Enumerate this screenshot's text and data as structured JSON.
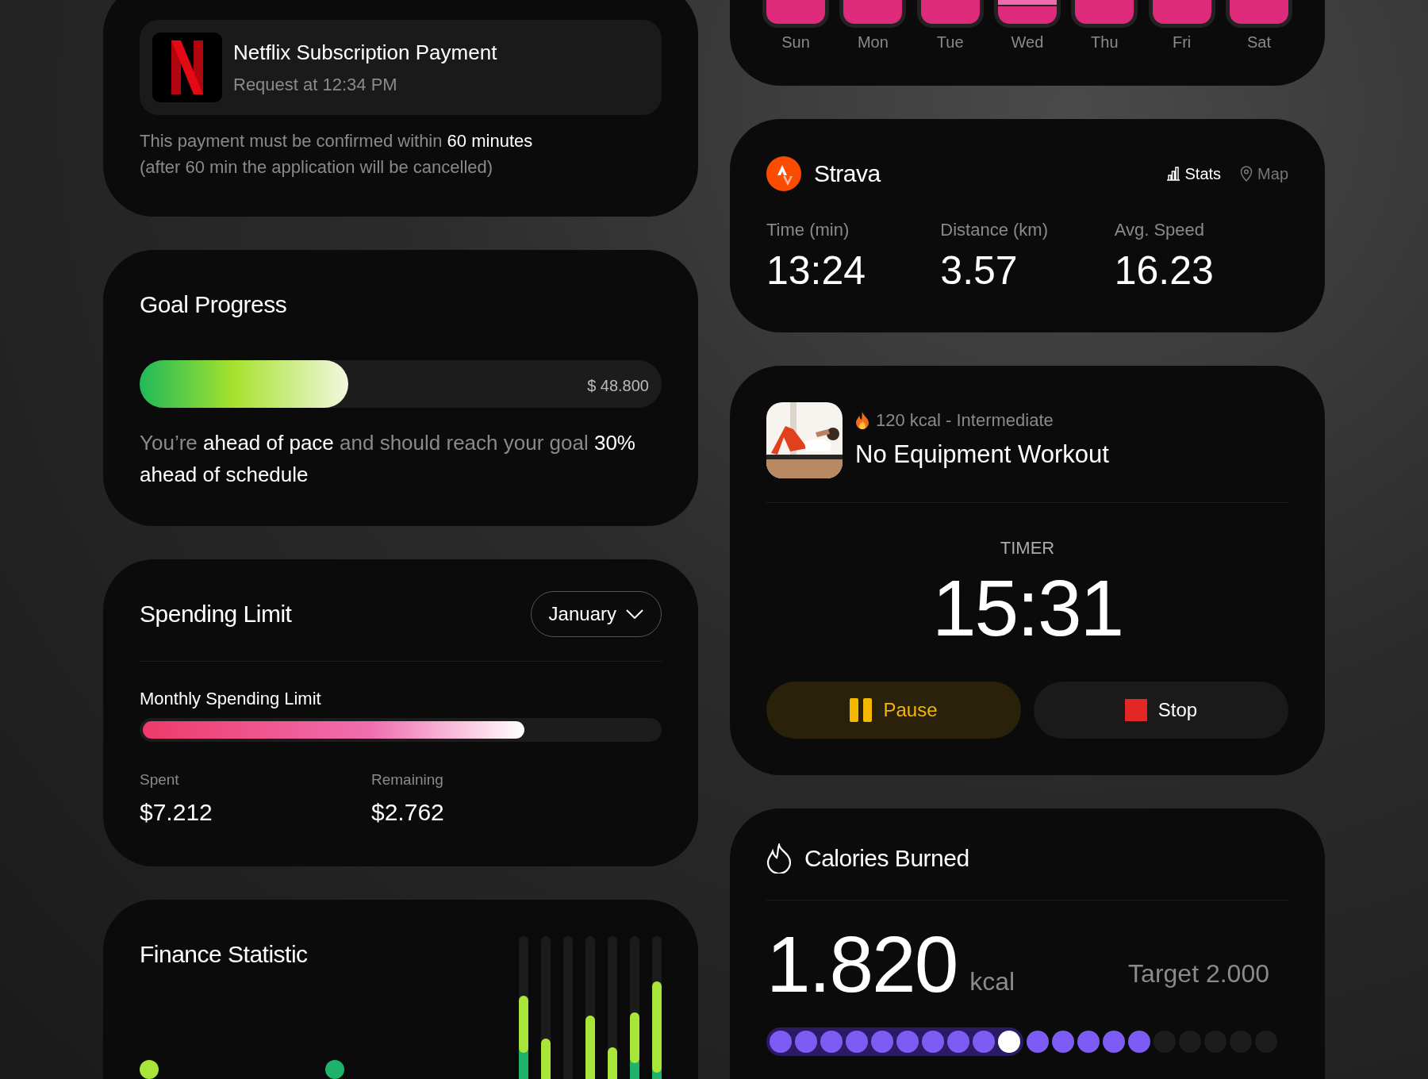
{
  "payment": {
    "title": "Netflix Subscription Payment",
    "subtitle": "Request at 12:34 PM",
    "notes": [
      "This payment must be confirmed within **60 minutes**",
      "(after 60 min the application will be cancelled)"
    ]
  },
  "goal": {
    "title": "Goal Progress",
    "level": 0.4,
    "amount": "$ 48.800",
    "message": "You’re **ahead of pace** and should reach your goal **30% ahead of schedule**"
  },
  "spending": {
    "title": "Spending Limit",
    "month": "January",
    "bar_label": "Monthly Spending Limit",
    "level": 0.74,
    "stats": [
      {
        "label": "Spent",
        "value": "$7.212"
      },
      {
        "label": "Remaining",
        "value": "$2.762"
      }
    ]
  },
  "finance": {
    "title": "Finance Statistic",
    "legend": [
      {
        "color": "#a8e63a"
      },
      {
        "color": "#1db36b"
      }
    ]
  },
  "week": {
    "days": [
      {
        "label": "Sun",
        "kind": "single"
      },
      {
        "label": "Mon",
        "kind": "single"
      },
      {
        "label": "Tue",
        "kind": "single"
      },
      {
        "label": "Wed",
        "kind": "split"
      },
      {
        "label": "Thu",
        "kind": "single"
      },
      {
        "label": "Fri",
        "kind": "single"
      },
      {
        "label": "Sat",
        "kind": "single"
      }
    ]
  },
  "strava": {
    "title": "Strava",
    "tabs": [
      {
        "label": "Stats",
        "kind": "stats",
        "selected": true
      },
      {
        "label": "Map",
        "kind": "map",
        "selected": false
      }
    ],
    "metrics": [
      {
        "label": "Time (min)",
        "value": "13:24"
      },
      {
        "label": "Distance (km)",
        "value": "3.57"
      },
      {
        "label": "Avg. Speed",
        "value": "16.23"
      }
    ]
  },
  "workout": {
    "meta": "120 kcal - Intermediate",
    "title": "No Equipment Workout",
    "timer_label": "TIMER",
    "timer": "15:31",
    "buttons": [
      {
        "label": "Pause",
        "kind": "pause"
      },
      {
        "label": "Stop",
        "kind": "stop"
      }
    ]
  },
  "calories": {
    "title": "Calories Burned",
    "value": "1.820",
    "unit": "kcal",
    "target": "Target 2.000",
    "dots": [
      {
        "kind": "past"
      },
      {
        "kind": "past"
      },
      {
        "kind": "past"
      },
      {
        "kind": "past"
      },
      {
        "kind": "past"
      },
      {
        "kind": "past"
      },
      {
        "kind": "past"
      },
      {
        "kind": "past"
      },
      {
        "kind": "past"
      },
      {
        "kind": "current"
      },
      {
        "kind": "filled"
      },
      {
        "kind": "filled"
      },
      {
        "kind": "filled"
      },
      {
        "kind": "filled"
      },
      {
        "kind": "filled"
      },
      {
        "kind": "empty"
      },
      {
        "kind": "empty"
      },
      {
        "kind": "empty"
      },
      {
        "kind": "empty"
      },
      {
        "kind": "empty"
      }
    ]
  }
}
